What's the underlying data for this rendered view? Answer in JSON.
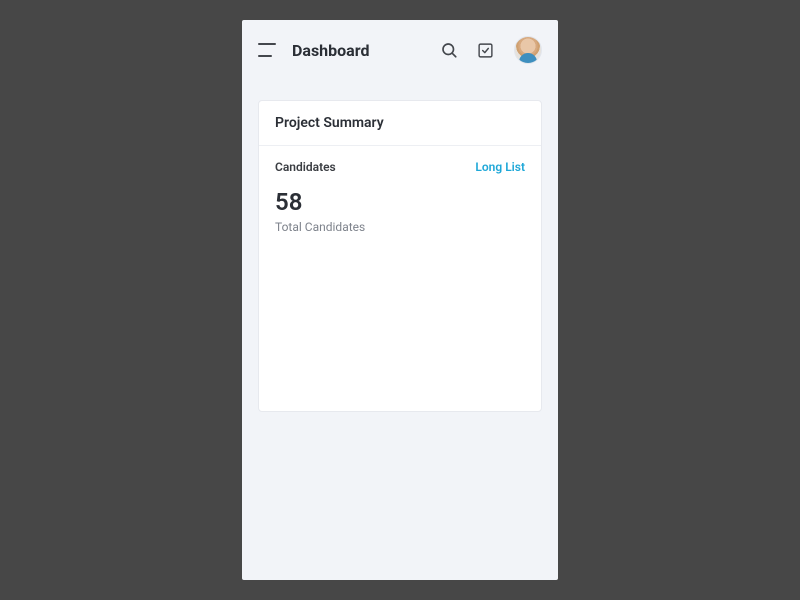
{
  "header": {
    "title": "Dashboard"
  },
  "card": {
    "title": "Project Summary",
    "section_label": "Candidates",
    "link_label": "Long List",
    "stat_value": "58",
    "stat_label": "Total Candidates"
  }
}
